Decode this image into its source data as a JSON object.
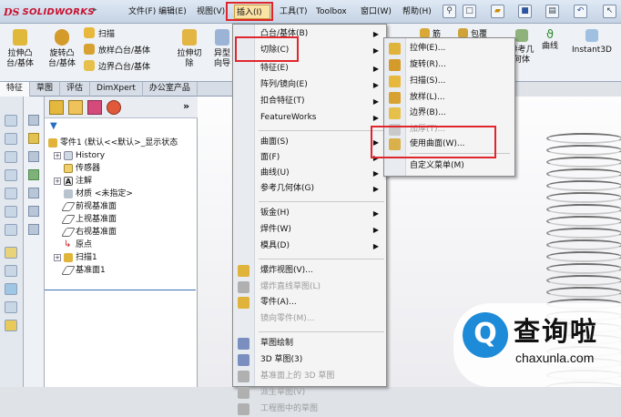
{
  "app": {
    "logo_ds": "DS",
    "logo_name": "SOLIDWORKS"
  },
  "menubar": [
    "文件(F)",
    "编辑(E)",
    "视图(V)",
    "插入(I)",
    "工具(T)",
    "Toolbox",
    "窗口(W)",
    "帮助(H)"
  ],
  "ribbon": {
    "left_buttons": [
      {
        "label": "拉伸凸\n台/基体",
        "icon": "extrude-boss-icon"
      },
      {
        "label": "旋转凸\n台/基体",
        "icon": "revolve-boss-icon"
      },
      {
        "label": "扫描",
        "icon": "sweep-icon"
      },
      {
        "label": "放样凸台/基体",
        "icon": "loft-boss-icon"
      },
      {
        "label": "边界凸台/基体",
        "icon": "boundary-boss-icon"
      }
    ],
    "mid_buttons": [
      {
        "label": "拉伸切\n除",
        "icon": "extrude-cut-icon"
      },
      {
        "label": "异型\n向导",
        "icon": "hole-wizard-icon"
      }
    ],
    "right_buttons": [
      {
        "label": "筋",
        "icon": "rib-icon"
      },
      {
        "label": "包覆",
        "icon": "wrap-icon"
      },
      {
        "label": "参考几\n何体",
        "icon": "reference-geometry-icon"
      },
      {
        "label": "曲线",
        "icon": "curves-icon"
      },
      {
        "label": "Instant3D",
        "icon": "instant3d-icon"
      }
    ]
  },
  "tabs": [
    "特征",
    "草图",
    "评估",
    "DimXpert",
    "办公室产品"
  ],
  "tree": {
    "root": "零件1 (默认<<默认>_显示状态",
    "items": [
      {
        "label": "History",
        "expand": "+"
      },
      {
        "label": "传感器",
        "expand": ""
      },
      {
        "label": "注解",
        "expand": "+"
      },
      {
        "label": "材质 <未指定>",
        "expand": ""
      },
      {
        "label": "前视基准面",
        "expand": ""
      },
      {
        "label": "上视基准面",
        "expand": ""
      },
      {
        "label": "右视基准面",
        "expand": ""
      },
      {
        "label": "原点",
        "expand": ""
      },
      {
        "label": "扫描1",
        "expand": "+"
      },
      {
        "label": "基准面1",
        "expand": ""
      }
    ]
  },
  "insert_menu": {
    "items": [
      {
        "label": "凸台/基体(B)",
        "arrow": true,
        "disabled": false
      },
      {
        "label": "切除(C)",
        "arrow": true,
        "disabled": false
      },
      {
        "label": "特征(E)",
        "arrow": true,
        "disabled": false
      },
      {
        "label": "阵列/镜向(E)",
        "arrow": true,
        "disabled": false
      },
      {
        "label": "扣合特征(T)",
        "arrow": true,
        "disabled": false
      },
      {
        "label": "FeatureWorks",
        "arrow": true,
        "disabled": false
      },
      {
        "label": "曲面(S)",
        "arrow": true,
        "disabled": false
      },
      {
        "label": "面(F)",
        "arrow": true,
        "disabled": false
      },
      {
        "label": "曲线(U)",
        "arrow": true,
        "disabled": false
      },
      {
        "label": "参考几何体(G)",
        "arrow": true,
        "disabled": false
      },
      {
        "label": "钣金(H)",
        "arrow": true,
        "disabled": false
      },
      {
        "label": "焊件(W)",
        "arrow": true,
        "disabled": false
      },
      {
        "label": "模具(D)",
        "arrow": true,
        "disabled": false
      },
      {
        "label": "爆炸视图(V)...",
        "arrow": false,
        "disabled": false
      },
      {
        "label": "爆炸直线草图(L)",
        "arrow": false,
        "disabled": true
      },
      {
        "label": "零件(A)...",
        "arrow": false,
        "disabled": false
      },
      {
        "label": "镜向零件(M)...",
        "arrow": false,
        "disabled": true
      },
      {
        "label": "草图绘制",
        "arrow": false,
        "disabled": false
      },
      {
        "label": "3D 草图(3)",
        "arrow": false,
        "disabled": false
      },
      {
        "label": "基准面上的 3D 草图",
        "arrow": false,
        "disabled": true
      },
      {
        "label": "派生草图(V)",
        "arrow": false,
        "disabled": true
      },
      {
        "label": "工程图中的草图",
        "arrow": false,
        "disabled": true
      }
    ]
  },
  "cut_submenu": {
    "items": [
      {
        "label": "拉伸(E)...",
        "disabled": false
      },
      {
        "label": "旋转(R)...",
        "disabled": false
      },
      {
        "label": "扫描(S)...",
        "disabled": false
      },
      {
        "label": "放样(L)...",
        "disabled": false
      },
      {
        "label": "边界(B)...",
        "disabled": false
      },
      {
        "label": "加厚(T)...",
        "disabled": true
      },
      {
        "label": "使用曲面(W)...",
        "disabled": false
      },
      {
        "label": "自定义菜单(M)",
        "disabled": false
      }
    ]
  },
  "watermark": {
    "symbol": "Q",
    "name": "查询啦",
    "url": "chaxunla.com"
  },
  "colors": {
    "highlight_box": "#e0262d",
    "menu_hover": "#fbe6a8",
    "watermark_blue": "#1d8bd8"
  }
}
